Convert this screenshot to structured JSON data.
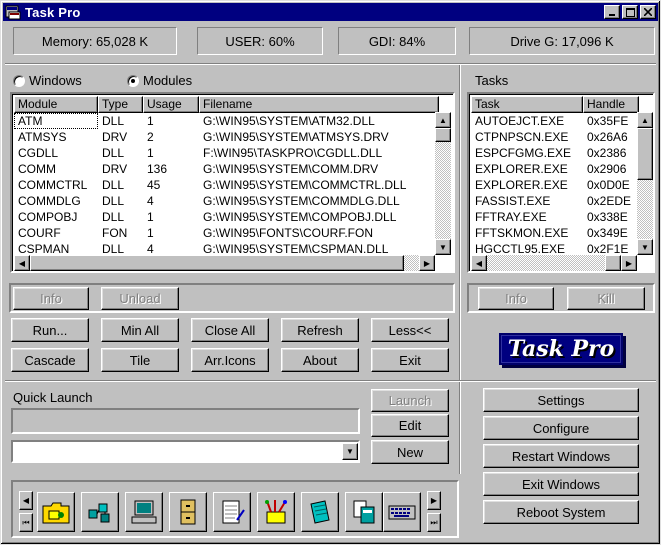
{
  "window": {
    "title": "Task Pro"
  },
  "stats": {
    "memory": "Memory: 65,028 K",
    "user": "USER: 60%",
    "gdi": "GDI: 84%",
    "drive": "Drive G: 17,096 K"
  },
  "view_mode": {
    "windows_label": "Windows",
    "modules_label": "Modules",
    "selected": "Modules"
  },
  "modules": {
    "columns": [
      "Module",
      "Type",
      "Usage",
      "Filename"
    ],
    "rows": [
      [
        "ATM",
        "DLL",
        "1",
        "G:\\WIN95\\SYSTEM\\ATM32.DLL"
      ],
      [
        "ATMSYS",
        "DRV",
        "2",
        "G:\\WIN95\\SYSTEM\\ATMSYS.DRV"
      ],
      [
        "CGDLL",
        "DLL",
        "1",
        "F:\\WIN95\\TASKPRO\\CGDLL.DLL"
      ],
      [
        "COMM",
        "DRV",
        "136",
        "G:\\WIN95\\SYSTEM\\COMM.DRV"
      ],
      [
        "COMMCTRL",
        "DLL",
        "45",
        "G:\\WIN95\\SYSTEM\\COMMCTRL.DLL"
      ],
      [
        "COMMDLG",
        "DLL",
        "4",
        "G:\\WIN95\\SYSTEM\\COMMDLG.DLL"
      ],
      [
        "COMPOBJ",
        "DLL",
        "1",
        "G:\\WIN95\\SYSTEM\\COMPOBJ.DLL"
      ],
      [
        "COURF",
        "FON",
        "1",
        "G:\\WIN95\\FONTS\\COURF.FON"
      ],
      [
        "CSPMAN",
        "DLL",
        "4",
        "G:\\WIN95\\SYSTEM\\CSPMAN.DLL"
      ]
    ]
  },
  "tasks": {
    "label": "Tasks",
    "columns": [
      "Task",
      "Handle"
    ],
    "rows": [
      [
        "AUTOEJCT.EXE",
        "0x35FE"
      ],
      [
        "CTPNPSCN.EXE",
        "0x26A6"
      ],
      [
        "ESPCFGMG.EXE",
        "0x2386"
      ],
      [
        "EXPLORER.EXE",
        "0x2906"
      ],
      [
        "EXPLORER.EXE",
        "0x0D0E"
      ],
      [
        "FASSIST.EXE",
        "0x2EDE"
      ],
      [
        "FFTRAY.EXE",
        "0x338E"
      ],
      [
        "FFTSKMON.EXE",
        "0x349E"
      ],
      [
        "HGCCTL95.EXE",
        "0x2F1E"
      ]
    ]
  },
  "buttons": {
    "info": "Info",
    "unload": "Unload",
    "task_info": "Info",
    "kill": "Kill",
    "run": "Run...",
    "min_all": "Min All",
    "close_all": "Close All",
    "refresh": "Refresh",
    "less": "Less<<",
    "cascade": "Cascade",
    "tile": "Tile",
    "arr_icons": "Arr.Icons",
    "about": "About",
    "exit": "Exit",
    "launch": "Launch",
    "edit": "Edit",
    "new": "New",
    "settings": "Settings",
    "configure": "Configure",
    "restart_windows": "Restart Windows",
    "exit_windows": "Exit Windows",
    "reboot_system": "Reboot System"
  },
  "logo_text": "Task Pro",
  "quick_launch": {
    "label": "Quick Launch",
    "command_value": "",
    "combo_value": ""
  },
  "icon_bar": [
    "folder-icon",
    "network-icon",
    "computer-icon",
    "cabinet-icon",
    "notepad-icon",
    "paint-icon",
    "notebook-icon",
    "documents-icon",
    "keyboard-icon"
  ],
  "colors": {
    "title_bar": "#000080",
    "face": "#c0c0c0",
    "logo_bg": "#000080"
  }
}
